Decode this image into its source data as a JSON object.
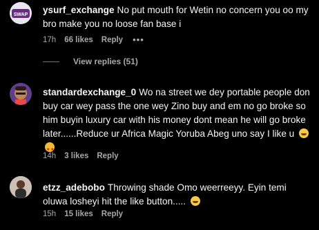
{
  "comments": [
    {
      "username": "ysurf_exchange",
      "text": "No put mouth for Wetin no concern you oo my bro make you no loose fan base i",
      "time": "17h",
      "likes": "66 likes",
      "reply": "Reply",
      "more": "•••",
      "view_replies": "View replies (51)"
    },
    {
      "username": "standardexchange_0",
      "text": "Wo na street we dey portable people don buy car wey pass the one wey Zino buy and em no go broke so him buyin luxury car with his money dont mean he will go broke later......Reduce ur Africa Magic Yoruba Abeg uno say I like u",
      "time": "14h",
      "likes": "3 likes",
      "reply": "Reply"
    },
    {
      "username": "etzz_adebobo",
      "text": "Throwing shade Omo weerreeyy. Eyin temi oluwa losheyi hit the like button.....",
      "time": "15h",
      "likes": "15 likes",
      "reply": "Reply"
    }
  ],
  "avatar_label": "SWAP"
}
